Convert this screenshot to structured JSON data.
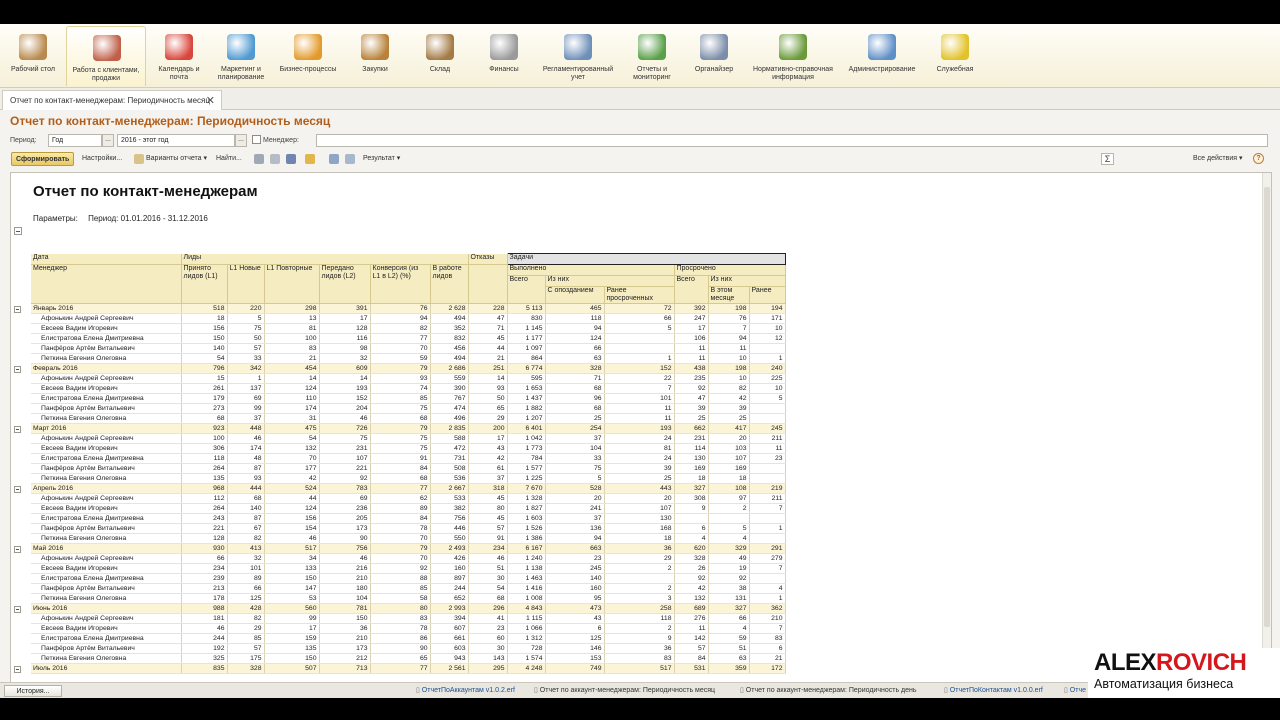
{
  "sections": [
    {
      "label": "Рабочий стол",
      "icon": "desk-icon",
      "color": "#b98a4e"
    },
    {
      "label": "Работа с клиентами, продажи",
      "icon": "clients-icon",
      "color": "#c0604a",
      "active": true
    },
    {
      "label": "Календарь и почта",
      "icon": "calendar-icon",
      "color": "#d9463c"
    },
    {
      "label": "Маркетинг и планирование",
      "icon": "marketing-icon",
      "color": "#4f9ad1"
    },
    {
      "label": "Бизнес-процессы",
      "icon": "process-icon",
      "color": "#e39a2c"
    },
    {
      "label": "Закупки",
      "icon": "purchases-icon",
      "color": "#b8823a"
    },
    {
      "label": "Склад",
      "icon": "warehouse-icon",
      "color": "#a47a45"
    },
    {
      "label": "Финансы",
      "icon": "finance-icon",
      "color": "#9a9a9a"
    },
    {
      "label": "Регламентированный учет",
      "icon": "accounting-icon",
      "color": "#6d8fb8"
    },
    {
      "label": "Отчеты и мониторинг",
      "icon": "reports-icon",
      "color": "#5aa04a"
    },
    {
      "label": "Органайзер",
      "icon": "organizer-icon",
      "color": "#7b8da8"
    },
    {
      "label": "Нормативно-справочная информация",
      "icon": "reference-icon",
      "color": "#6a9a3a"
    },
    {
      "label": "Администрирование",
      "icon": "admin-icon",
      "color": "#5f8fc7"
    },
    {
      "label": "Служебная",
      "icon": "service-icon",
      "color": "#e2c22a"
    }
  ],
  "tab": {
    "label": "Отчет по контакт-менеджерам: Периодичность месяц",
    "close": "✕"
  },
  "page_title": "Отчет по контакт-менеджерам: Периодичность месяц",
  "params": {
    "period_label": "Период:",
    "period_value": "Год",
    "period_range": "2016 - этот год",
    "manager_label": "Менеджер:",
    "dots": "..."
  },
  "toolbar": {
    "generate": "Сформировать",
    "settings": "Настройки...",
    "variants": "Варианты отчета",
    "find": "Найти...",
    "result": "Результат",
    "all_actions": "Все действия",
    "help": "?",
    "sigma": "Σ"
  },
  "report": {
    "title": "Отчет по контакт-менеджерам",
    "params_label": "Параметры:",
    "params_value": "Период: 01.01.2016 - 31.12.2016",
    "headers": {
      "date": "Дата",
      "manager": "Менеджер",
      "leads": "Лиды",
      "refusals": "Отказы",
      "tasks": "Задачи",
      "accepted": "Принято лидов (L1)",
      "l1_new": "L1 Новые",
      "l1_repeat": "L1 Повторные",
      "transferred": "Передано лидов (L2)",
      "conversion": "Конверсия (из L1 в L2) (%)",
      "in_work": "В работе лидов",
      "done": "Выполнено",
      "overdue": "Просрочено",
      "total": "Всего",
      "of_them": "Из них",
      "late": "С опозданием",
      "earlier_overdue": "Ранее просроченных",
      "total2": "Всего",
      "of_them2": "Из них",
      "this_month": "В этом месяце",
      "earlier": "Ранее"
    },
    "rows": [
      {
        "g": true,
        "name": "Январь 2016",
        "v": [
          "518",
          "220",
          "298",
          "391",
          "76",
          "2 628",
          "228",
          "5 113",
          "465",
          "72",
          "392",
          "198",
          "194"
        ]
      },
      {
        "name": "Афонькин Андрей Сергеевич",
        "v": [
          "18",
          "5",
          "13",
          "17",
          "94",
          "494",
          "47",
          "830",
          "118",
          "66",
          "247",
          "76",
          "171"
        ]
      },
      {
        "name": "Евсеев Вадим Игоревич",
        "v": [
          "156",
          "75",
          "81",
          "128",
          "82",
          "352",
          "71",
          "1 145",
          "94",
          "5",
          "17",
          "7",
          "10"
        ]
      },
      {
        "name": "Елистратова Елена Дмитриевна",
        "v": [
          "150",
          "50",
          "100",
          "116",
          "77",
          "832",
          "45",
          "1 177",
          "124",
          "",
          "106",
          "94",
          "12"
        ]
      },
      {
        "name": "Панфёров Артём Витальевич",
        "v": [
          "140",
          "57",
          "83",
          "98",
          "70",
          "456",
          "44",
          "1 097",
          "66",
          "",
          "11",
          "11",
          ""
        ]
      },
      {
        "name": "Петкина Евгения Олеговна",
        "v": [
          "54",
          "33",
          "21",
          "32",
          "59",
          "494",
          "21",
          "864",
          "63",
          "1",
          "11",
          "10",
          "1"
        ]
      },
      {
        "g": true,
        "name": "Февраль 2016",
        "v": [
          "796",
          "342",
          "454",
          "609",
          "79",
          "2 686",
          "251",
          "6 774",
          "328",
          "152",
          "438",
          "198",
          "240"
        ]
      },
      {
        "name": "Афонькин Андрей Сергеевич",
        "v": [
          "15",
          "1",
          "14",
          "14",
          "93",
          "559",
          "14",
          "595",
          "71",
          "22",
          "235",
          "10",
          "225"
        ]
      },
      {
        "name": "Евсеев Вадим Игоревич",
        "v": [
          "261",
          "137",
          "124",
          "193",
          "74",
          "390",
          "93",
          "1 653",
          "68",
          "7",
          "92",
          "82",
          "10"
        ]
      },
      {
        "name": "Елистратова Елена Дмитриевна",
        "v": [
          "179",
          "69",
          "110",
          "152",
          "85",
          "767",
          "50",
          "1 437",
          "96",
          "101",
          "47",
          "42",
          "5"
        ]
      },
      {
        "name": "Панфёров Артём Витальевич",
        "v": [
          "273",
          "99",
          "174",
          "204",
          "75",
          "474",
          "65",
          "1 882",
          "68",
          "11",
          "39",
          "39",
          ""
        ]
      },
      {
        "name": "Петкина Евгения Олеговна",
        "v": [
          "68",
          "37",
          "31",
          "46",
          "68",
          "496",
          "29",
          "1 207",
          "25",
          "11",
          "25",
          "25",
          ""
        ]
      },
      {
        "g": true,
        "name": "Март 2016",
        "v": [
          "923",
          "448",
          "475",
          "726",
          "79",
          "2 835",
          "200",
          "6 401",
          "254",
          "193",
          "662",
          "417",
          "245"
        ]
      },
      {
        "name": "Афонькин Андрей Сергеевич",
        "v": [
          "100",
          "46",
          "54",
          "75",
          "75",
          "588",
          "17",
          "1 042",
          "37",
          "24",
          "231",
          "20",
          "211"
        ]
      },
      {
        "name": "Евсеев Вадим Игоревич",
        "v": [
          "306",
          "174",
          "132",
          "231",
          "75",
          "472",
          "43",
          "1 773",
          "104",
          "81",
          "114",
          "103",
          "11"
        ]
      },
      {
        "name": "Елистратова Елена Дмитриевна",
        "v": [
          "118",
          "48",
          "70",
          "107",
          "91",
          "731",
          "42",
          "784",
          "33",
          "24",
          "130",
          "107",
          "23"
        ]
      },
      {
        "name": "Панфёров Артём Витальевич",
        "v": [
          "264",
          "87",
          "177",
          "221",
          "84",
          "508",
          "61",
          "1 577",
          "75",
          "39",
          "169",
          "169",
          ""
        ]
      },
      {
        "name": "Петкина Евгения Олеговна",
        "v": [
          "135",
          "93",
          "42",
          "92",
          "68",
          "536",
          "37",
          "1 225",
          "5",
          "25",
          "18",
          "18",
          ""
        ]
      },
      {
        "g": true,
        "name": "Апрель 2016",
        "v": [
          "968",
          "444",
          "524",
          "783",
          "77",
          "2 667",
          "318",
          "7 670",
          "528",
          "443",
          "327",
          "108",
          "219"
        ]
      },
      {
        "name": "Афонькин Андрей Сергеевич",
        "v": [
          "112",
          "68",
          "44",
          "69",
          "62",
          "533",
          "45",
          "1 328",
          "20",
          "20",
          "308",
          "97",
          "211"
        ]
      },
      {
        "name": "Евсеев Вадим Игоревич",
        "v": [
          "264",
          "140",
          "124",
          "236",
          "89",
          "382",
          "80",
          "1 827",
          "241",
          "107",
          "9",
          "2",
          "7"
        ]
      },
      {
        "name": "Елистратова Елена Дмитриевна",
        "v": [
          "243",
          "87",
          "156",
          "205",
          "84",
          "756",
          "45",
          "1 603",
          "37",
          "130",
          "",
          "",
          ""
        ]
      },
      {
        "name": "Панфёров Артём Витальевич",
        "v": [
          "221",
          "67",
          "154",
          "173",
          "78",
          "446",
          "57",
          "1 526",
          "136",
          "168",
          "6",
          "5",
          "1"
        ]
      },
      {
        "name": "Петкина Евгения Олеговна",
        "v": [
          "128",
          "82",
          "46",
          "90",
          "70",
          "550",
          "91",
          "1 386",
          "94",
          "18",
          "4",
          "4",
          ""
        ]
      },
      {
        "g": true,
        "name": "Май 2016",
        "v": [
          "930",
          "413",
          "517",
          "756",
          "79",
          "2 493",
          "234",
          "6 167",
          "663",
          "36",
          "620",
          "329",
          "291"
        ]
      },
      {
        "name": "Афонькин Андрей Сергеевич",
        "v": [
          "66",
          "32",
          "34",
          "46",
          "70",
          "426",
          "46",
          "1 240",
          "23",
          "29",
          "328",
          "49",
          "279"
        ]
      },
      {
        "name": "Евсеев Вадим Игоревич",
        "v": [
          "234",
          "101",
          "133",
          "216",
          "92",
          "160",
          "51",
          "1 138",
          "245",
          "2",
          "26",
          "19",
          "7"
        ]
      },
      {
        "name": "Елистратова Елена Дмитриевна",
        "v": [
          "239",
          "89",
          "150",
          "210",
          "88",
          "897",
          "30",
          "1 463",
          "140",
          "",
          "92",
          "92",
          ""
        ]
      },
      {
        "name": "Панфёров Артём Витальевич",
        "v": [
          "213",
          "66",
          "147",
          "180",
          "85",
          "244",
          "54",
          "1 416",
          "160",
          "2",
          "42",
          "38",
          "4"
        ]
      },
      {
        "name": "Петкина Евгения Олеговна",
        "v": [
          "178",
          "125",
          "53",
          "104",
          "58",
          "652",
          "68",
          "1 008",
          "95",
          "3",
          "132",
          "131",
          "1"
        ]
      },
      {
        "g": true,
        "name": "Июнь 2016",
        "v": [
          "988",
          "428",
          "560",
          "781",
          "80",
          "2 993",
          "296",
          "4 843",
          "473",
          "258",
          "689",
          "327",
          "362"
        ]
      },
      {
        "name": "Афонькин Андрей Сергеевич",
        "v": [
          "181",
          "82",
          "99",
          "150",
          "83",
          "394",
          "41",
          "1 115",
          "43",
          "118",
          "276",
          "66",
          "210"
        ]
      },
      {
        "name": "Евсеев Вадим Игоревич",
        "v": [
          "46",
          "29",
          "17",
          "36",
          "78",
          "607",
          "23",
          "1 066",
          "6",
          "2",
          "11",
          "4",
          "7"
        ]
      },
      {
        "name": "Елистратова Елена Дмитриевна",
        "v": [
          "244",
          "85",
          "159",
          "210",
          "86",
          "661",
          "60",
          "1 312",
          "125",
          "9",
          "142",
          "59",
          "83"
        ]
      },
      {
        "name": "Панфёров Артём Витальевич",
        "v": [
          "192",
          "57",
          "135",
          "173",
          "90",
          "603",
          "30",
          "728",
          "146",
          "36",
          "57",
          "51",
          "6"
        ]
      },
      {
        "name": "Петкина Евгения Олеговна",
        "v": [
          "325",
          "175",
          "150",
          "212",
          "65",
          "943",
          "143",
          "1 574",
          "153",
          "83",
          "84",
          "63",
          "21"
        ]
      },
      {
        "g": true,
        "name": "Июль 2016",
        "v": [
          "835",
          "328",
          "507",
          "713",
          "77",
          "2 561",
          "295",
          "4 248",
          "749",
          "517",
          "531",
          "359",
          "172"
        ]
      }
    ]
  },
  "status": {
    "history": "История...",
    "windows": [
      "ОтчетПоАккаунтам v1.0.2.erf",
      "Отчет по аккаунт-менеджерам: Периодичность месяц",
      "Отчет по аккаунт-менеджерам: Периодичность день",
      "ОтчетПоКонтактам v1.0.0.erf",
      "Отче"
    ]
  },
  "brand": {
    "a": "ALEX",
    "b": "ROVICH",
    "tagline": "Автоматизация бизнеса",
    "accent": "#d3171d"
  }
}
